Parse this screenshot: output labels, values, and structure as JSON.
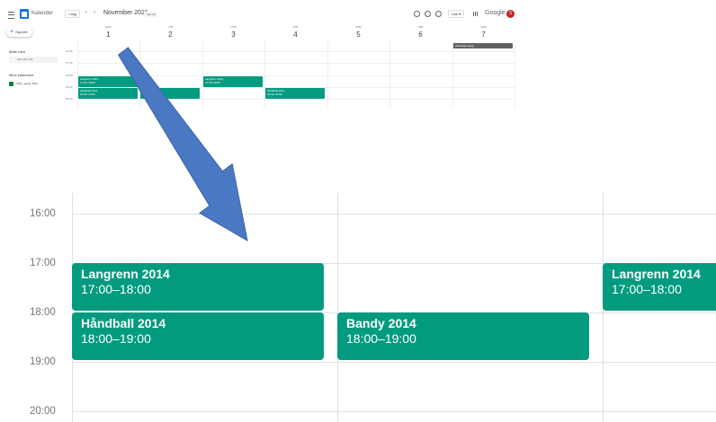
{
  "header": {
    "app_name": "Kalender",
    "today_label": "I dag",
    "prev_label": "‹",
    "next_label": "›",
    "month_label": "November 2021",
    "week_badge": "Uke 44",
    "view_label": "Uke ▾",
    "google_label": "Google",
    "avatar_letter": "S"
  },
  "sidebar": {
    "create_label": "Opprett",
    "meet_label": "Møte med",
    "people_search_placeholder": "Søk etter folk",
    "my_calendars_label": "Mine kalendere",
    "calendars": [
      "IdrAL_gutter 2014"
    ]
  },
  "week_view": {
    "days": [
      {
        "weekday": "MAN",
        "date": "1"
      },
      {
        "weekday": "TIR",
        "date": "2"
      },
      {
        "weekday": "ONS",
        "date": "3"
      },
      {
        "weekday": "TOR",
        "date": "4"
      },
      {
        "weekday": "FRE",
        "date": "5"
      },
      {
        "weekday": "LØR",
        "date": "6"
      },
      {
        "weekday": "SØN",
        "date": "7"
      }
    ],
    "hours": [
      "16:00",
      "17:00",
      "18:00",
      "19:00",
      "20:00"
    ],
    "all_day_event": "Allehelgensdag",
    "events": [
      {
        "title": "Langrenn 2014",
        "time": "17:00–18:00",
        "day": 1
      },
      {
        "title": "Håndball 2014",
        "time": "18:00–19:00",
        "day": 1
      },
      {
        "title": "Bandy 2014",
        "time": "18:00–19:00",
        "day": 2
      },
      {
        "title": "Langrenn 2014",
        "time": "17:00–18:00",
        "day": 3
      },
      {
        "title": "Håndball 2014",
        "time": "18:00–19:00",
        "day": 4
      }
    ]
  },
  "zoom": {
    "hours": [
      "16:00",
      "17:00",
      "18:00",
      "19:00",
      "20:00"
    ],
    "events": [
      {
        "title": "Langrenn 2014",
        "time": "17:00–18:00"
      },
      {
        "title": "Håndball 2014",
        "time": "18:00–19:00"
      },
      {
        "title": "Bandy 2014",
        "time": "18:00–19:00"
      },
      {
        "title": "Langrenn 2014",
        "time": "17:00–18:00"
      }
    ]
  },
  "colors": {
    "event": "#039b7f",
    "arrow": "#4a78c2",
    "all_day": "#616161"
  }
}
